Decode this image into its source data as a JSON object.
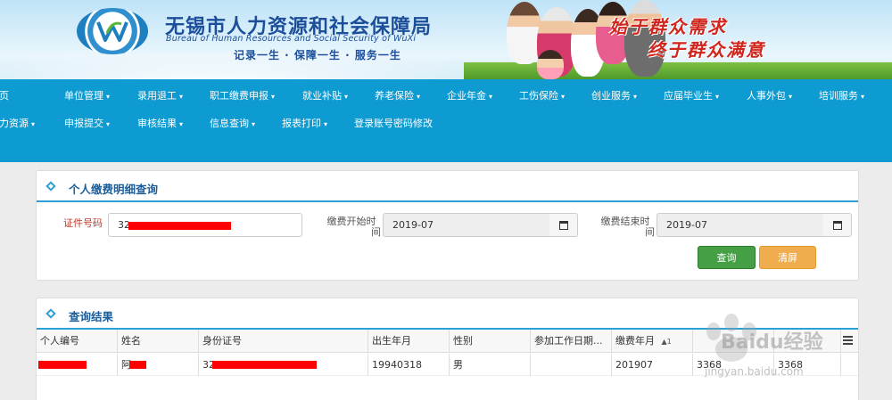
{
  "banner": {
    "title": "无锡市人力资源和社会保障局",
    "title_en": "Bureau of Human Resources and Social Security of WuXi",
    "slogan": "记录一生 · 保障一生 · 服务一生",
    "motto_line1": "始于群众需求",
    "motto_line2": "终于群众满意"
  },
  "nav": {
    "row1": [
      {
        "label": "页"
      },
      {
        "label": "单位管理"
      },
      {
        "label": "录用退工"
      },
      {
        "label": "职工缴费申报"
      },
      {
        "label": "就业补贴"
      },
      {
        "label": "养老保险"
      },
      {
        "label": "企业年金"
      },
      {
        "label": "工伤保险"
      },
      {
        "label": "创业服务"
      },
      {
        "label": "应届毕业生"
      },
      {
        "label": "人事外包"
      },
      {
        "label": "培训服务"
      }
    ],
    "row2": [
      {
        "label": "力资源"
      },
      {
        "label": "申报提交"
      },
      {
        "label": "审核结果"
      },
      {
        "label": "信息查询"
      },
      {
        "label": "报表打印"
      },
      {
        "label": "登录账号密码修改"
      }
    ],
    "caret": "▾"
  },
  "query_panel": {
    "title": "个人缴费明细查询",
    "id_label": "证件号码",
    "id_value": "32",
    "start_label_line1": "缴费开始时",
    "start_label_line2": "间",
    "start_value": "2019-07",
    "end_label_line1": "缴费结束时",
    "end_label_line2": "间",
    "end_value": "2019-07",
    "query_button": "查询",
    "clear_button": "清屏"
  },
  "result_panel": {
    "title": "查询结果",
    "columns": [
      "个人编号",
      "姓名",
      "身份证号",
      "出生年月",
      "性别",
      "参加工作日期...",
      "缴费年月",
      "",
      ""
    ],
    "sort_indicator": "▲1",
    "rows": [
      {
        "cells": [
          "",
          "阿",
          "32",
          "19940318",
          "男",
          "",
          "201907",
          "3368",
          "3368"
        ]
      }
    ]
  },
  "watermark": {
    "text": "Baidu经验",
    "sub": "jingyan.baidu.com"
  },
  "colors": {
    "nav_bg": "#0e9bd1",
    "panel_accent": "#2aa0d4",
    "query_btn": "#45a045",
    "clear_btn": "#f0ad4e",
    "motto": "#d0261e",
    "redaction": "#ff0000"
  }
}
